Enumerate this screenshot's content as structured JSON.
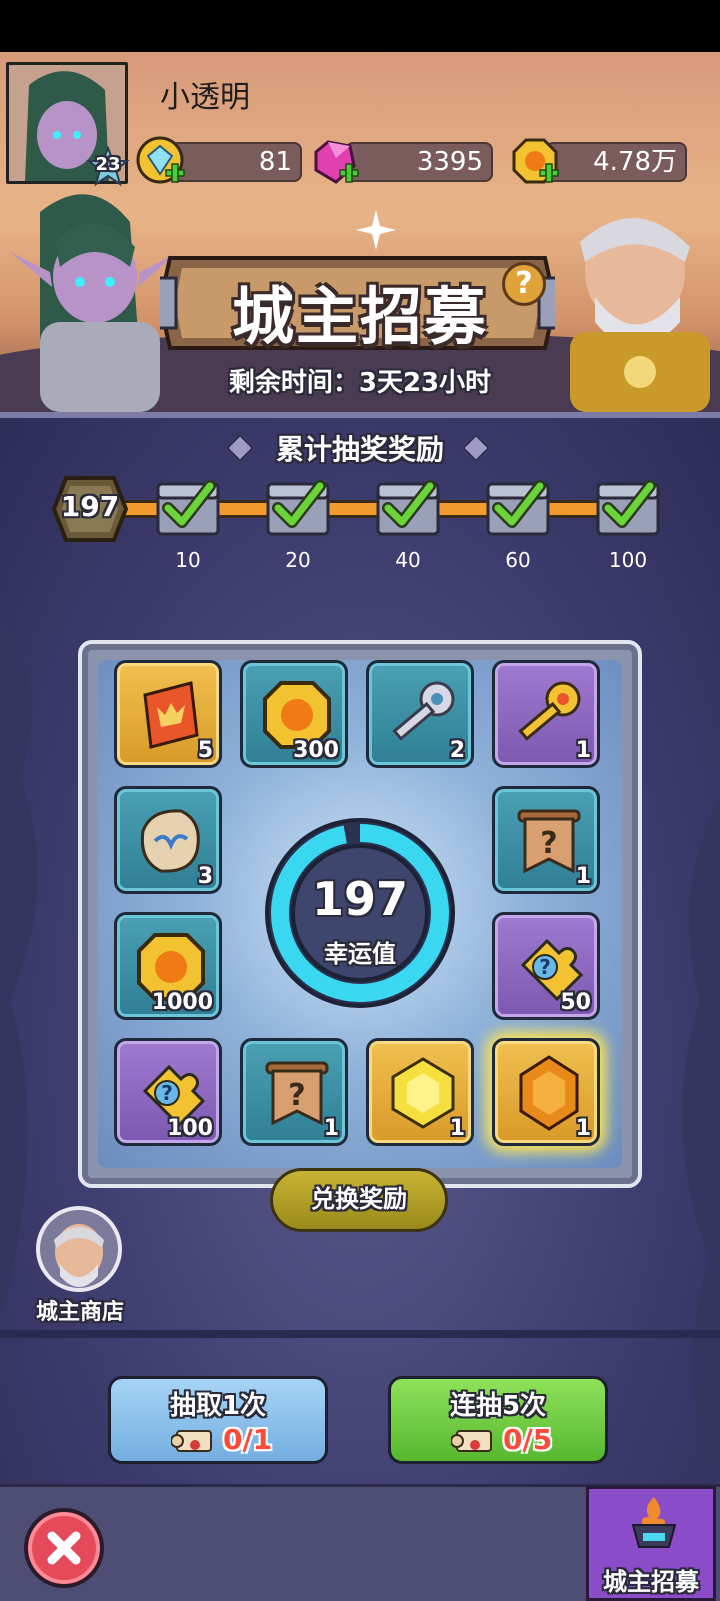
{
  "player": {
    "name": "小透明",
    "level": "23"
  },
  "resources": [
    {
      "name": "diamond",
      "value": "81",
      "icon": "blue-gem-icon"
    },
    {
      "name": "gem",
      "value": "3395",
      "icon": "pink-gem-icon"
    },
    {
      "name": "gold",
      "value": "4.78万",
      "icon": "gold-coin-icon"
    }
  ],
  "event": {
    "title": "城主招募",
    "help": "?",
    "remaining": "剩余时间：3天23小时"
  },
  "cumulative": {
    "title": "累计抽奖奖励",
    "count": "197",
    "milestones": [
      "10",
      "20",
      "40",
      "60",
      "100"
    ]
  },
  "board": {
    "slots": [
      {
        "qty": "5",
        "icon": "honor-card-icon",
        "style": "gold"
      },
      {
        "qty": "300",
        "icon": "gold-coin-icon",
        "style": "teal"
      },
      {
        "qty": "2",
        "icon": "silver-key-icon",
        "style": "teal"
      },
      {
        "qty": "1",
        "icon": "gold-key-icon",
        "style": "purple"
      },
      {
        "qty": "3",
        "icon": "rune-stone-icon",
        "style": "teal"
      },
      {
        "qty": "1",
        "icon": "mystery-scroll-icon",
        "style": "teal"
      },
      {
        "qty": "1000",
        "icon": "gold-coin-icon",
        "style": "teal"
      },
      {
        "qty": "50",
        "icon": "puzzle-piece-icon",
        "style": "purple"
      },
      {
        "qty": "100",
        "icon": "puzzle-piece-icon",
        "style": "purple"
      },
      {
        "qty": "1",
        "icon": "mystery-scroll-icon",
        "style": "teal"
      },
      {
        "qty": "1",
        "icon": "yellow-crystal-icon",
        "style": "gold"
      },
      {
        "qty": "1",
        "icon": "amber-crystal-icon",
        "style": "gold"
      }
    ],
    "luck_value": "197",
    "luck_label": "幸运值",
    "luck_fraction": 0.97,
    "exchange_label": "兑换奖励"
  },
  "shop": {
    "label": "城主商店"
  },
  "draw_once": {
    "label": "抽取1次",
    "progress": "0/1"
  },
  "draw_five": {
    "label": "连抽5次",
    "progress": "0/5"
  },
  "nav": {
    "active_tab": "城主招募"
  },
  "colors": {
    "accent_orange": "#f29a2e",
    "ring_cyan": "#3ad8f0",
    "close_red": "#e44a5a",
    "btn_green": "#6ad43a",
    "btn_blue": "#8cc4f0"
  }
}
